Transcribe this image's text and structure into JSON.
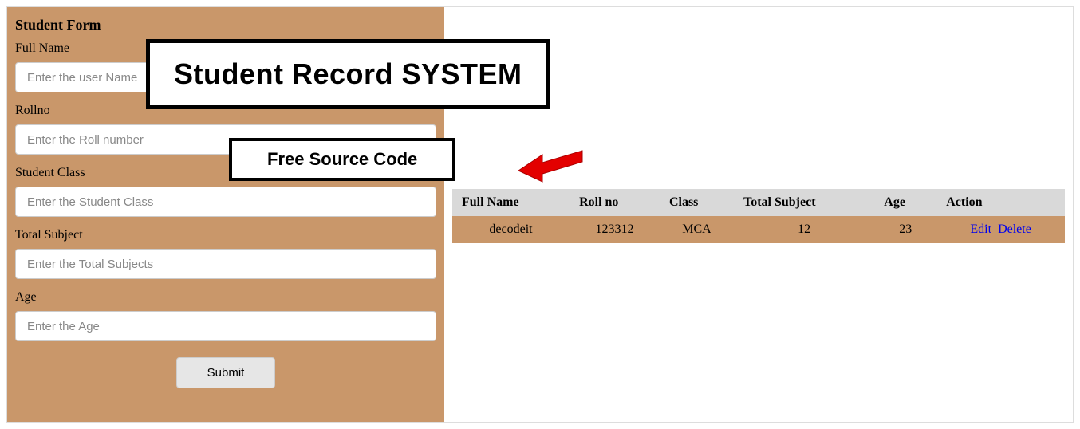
{
  "form": {
    "title": "Student Form",
    "fullName": {
      "label": "Full Name",
      "placeholder": "Enter the user Name"
    },
    "rollno": {
      "label": "Rollno",
      "placeholder": "Enter the Roll number"
    },
    "studentClass": {
      "label": "Student Class",
      "placeholder": "Enter the Student Class"
    },
    "totalSubject": {
      "label": "Total Subject",
      "placeholder": "Enter the Total Subjects"
    },
    "age": {
      "label": "Age",
      "placeholder": "Enter the Age"
    },
    "submitLabel": "Submit"
  },
  "overlay": {
    "title": "Student Record SYSTEM",
    "subtitle": "Free Source Code"
  },
  "table": {
    "headers": {
      "fullName": "Full Name",
      "rollno": "Roll no",
      "class": "Class",
      "totalSubject": "Total Subject",
      "age": "Age",
      "action": "Action"
    },
    "row": {
      "fullName": "decodeit",
      "rollno": "123312",
      "class": "MCA",
      "totalSubject": "12",
      "age": "23",
      "editLabel": "Edit",
      "deleteLabel": "Delete"
    }
  }
}
